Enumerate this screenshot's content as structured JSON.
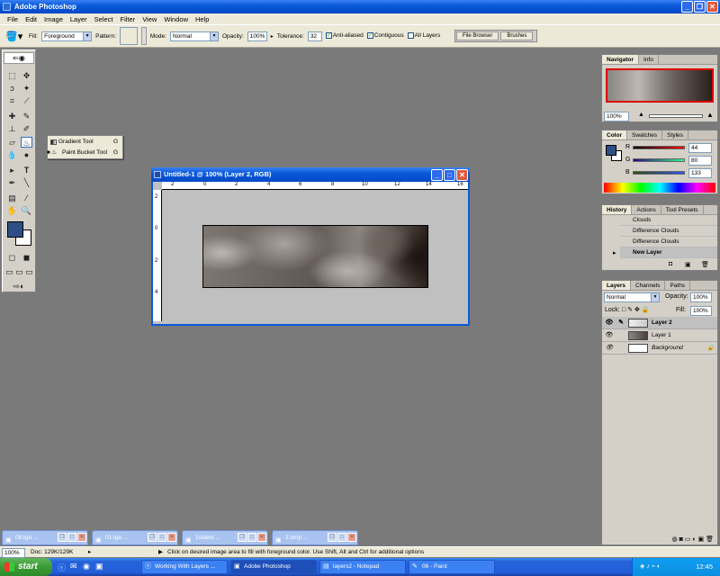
{
  "app": {
    "title": "Adobe Photoshop"
  },
  "menu": [
    "File",
    "Edit",
    "Image",
    "Layer",
    "Select",
    "Filter",
    "View",
    "Window",
    "Help"
  ],
  "options": {
    "fill_label": "Fill:",
    "fill_value": "Foreground",
    "pattern_label": "Pattern:",
    "mode_label": "Mode:",
    "mode_value": "Normal",
    "opacity_label": "Opacity:",
    "opacity_value": "100%",
    "tolerance_label": "Tolerance:",
    "tolerance_value": "32",
    "anti_aliased": "Anti-aliased",
    "contiguous": "Contiguous",
    "all_layers": "All Layers",
    "well_tabs": [
      "File Browser",
      "Brushes"
    ]
  },
  "flyout": [
    {
      "label": "Gradient Tool",
      "key": "G"
    },
    {
      "label": "Paint Bucket Tool",
      "key": "G"
    }
  ],
  "document": {
    "title": "Untitled-1 @ 100% (Layer 2, RGB)",
    "ruler_top": [
      "2",
      "0",
      "2",
      "4",
      "6",
      "8",
      "10",
      "12",
      "14",
      "16"
    ],
    "ruler_left": [
      "2",
      "0",
      "2",
      "4"
    ]
  },
  "navigator": {
    "tabs": [
      "Navigator",
      "Info"
    ],
    "zoom": "100%"
  },
  "color": {
    "tabs": [
      "Color",
      "Swatches",
      "Styles"
    ],
    "r_label": "R",
    "r": "44",
    "g_label": "G",
    "g": "80",
    "b_label": "B",
    "b": "133",
    "fg": "#2c5085"
  },
  "history": {
    "tabs": [
      "History",
      "Actions",
      "Tool Presets"
    ],
    "items": [
      "Clouds",
      "Difference Clouds",
      "Difference Clouds",
      "New Layer"
    ]
  },
  "layers": {
    "tabs": [
      "Layers",
      "Channels",
      "Paths"
    ],
    "blend": "Normal",
    "opacity_label": "Opacity:",
    "opacity": "100%",
    "lock_label": "Lock:",
    "fill_label": "Fill:",
    "fill": "100%",
    "items": [
      "Layer 2",
      "Layer 1",
      "Background"
    ]
  },
  "minimized": [
    "08.tga ...",
    "01.tga ...",
    "1stabst ...",
    "2.bmp ..."
  ],
  "status": {
    "zoom": "100%",
    "doc": "Doc: 129K/129K",
    "hint": "Click on desired image area to fill with foreground color.  Use Shift, Alt and Ctrl for additional options"
  },
  "taskbar": {
    "start": "start",
    "tasks": [
      "Working With Layers ...",
      "Adobe Photoshop",
      "layers2 - Notepad",
      "06 - Paint"
    ],
    "clock": "12:45"
  }
}
